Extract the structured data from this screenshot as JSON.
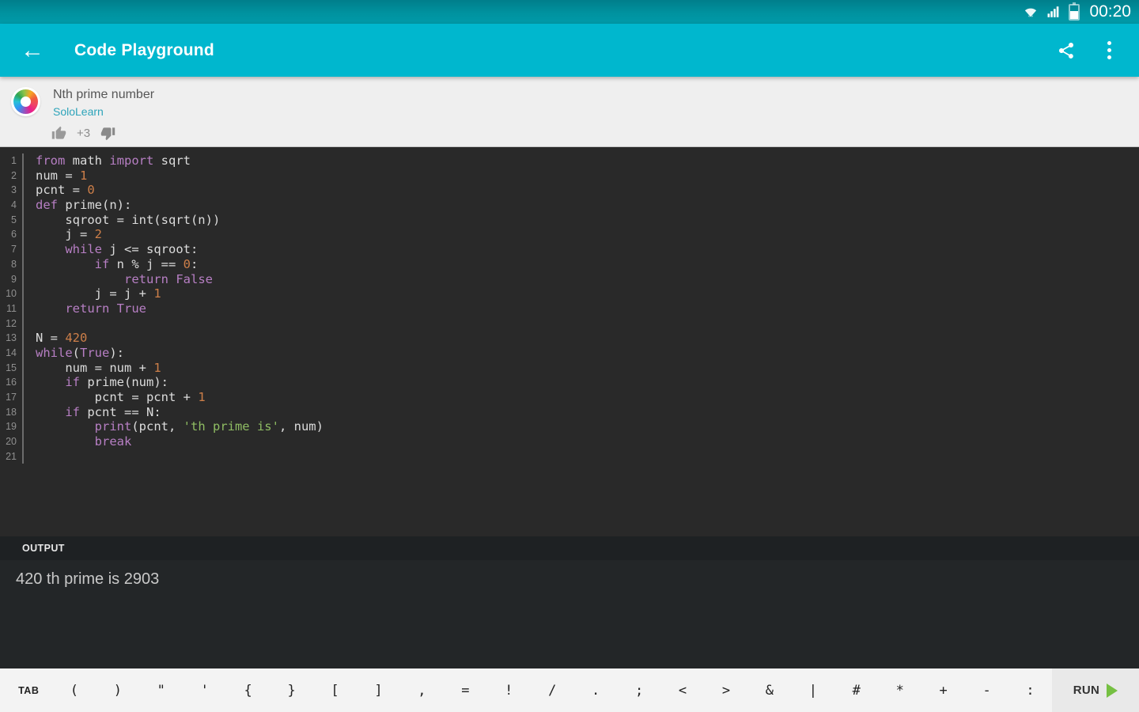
{
  "colors": {
    "accent": "#00b7ce",
    "keyword": "#b77fc4",
    "number": "#cd7f49",
    "string": "#8fbd63",
    "plain": "#dcdcdc",
    "run": "#76c043"
  },
  "status_bar": {
    "time": "00:20"
  },
  "app_bar": {
    "title": "Code Playground"
  },
  "code_header": {
    "title": "Nth prime number",
    "author": "SoloLearn",
    "votes": "+3"
  },
  "editor": {
    "lines": [
      {
        "n": "1",
        "seg": [
          [
            "k",
            "from"
          ],
          [
            "p",
            " math "
          ],
          [
            "k",
            "import"
          ],
          [
            "p",
            " sqrt"
          ]
        ]
      },
      {
        "n": "2",
        "seg": [
          [
            "p",
            "num = "
          ],
          [
            "n",
            "1"
          ]
        ]
      },
      {
        "n": "3",
        "seg": [
          [
            "p",
            "pcnt = "
          ],
          [
            "n",
            "0"
          ]
        ]
      },
      {
        "n": "4",
        "seg": [
          [
            "k",
            "def"
          ],
          [
            "p",
            " prime(n):"
          ]
        ]
      },
      {
        "n": "5",
        "seg": [
          [
            "p",
            "    sqroot = int(sqrt(n))"
          ]
        ]
      },
      {
        "n": "6",
        "seg": [
          [
            "p",
            "    j = "
          ],
          [
            "n",
            "2"
          ]
        ]
      },
      {
        "n": "7",
        "seg": [
          [
            "p",
            "    "
          ],
          [
            "k",
            "while"
          ],
          [
            "p",
            " j <= sqroot:"
          ]
        ]
      },
      {
        "n": "8",
        "seg": [
          [
            "p",
            "        "
          ],
          [
            "k",
            "if"
          ],
          [
            "p",
            " n % j == "
          ],
          [
            "n",
            "0"
          ],
          [
            "p",
            ":"
          ]
        ]
      },
      {
        "n": "9",
        "seg": [
          [
            "p",
            "            "
          ],
          [
            "k",
            "return"
          ],
          [
            "p",
            " "
          ],
          [
            "k",
            "False"
          ]
        ]
      },
      {
        "n": "10",
        "seg": [
          [
            "p",
            "        j = j + "
          ],
          [
            "n",
            "1"
          ]
        ]
      },
      {
        "n": "11",
        "seg": [
          [
            "p",
            "    "
          ],
          [
            "k",
            "return"
          ],
          [
            "p",
            " "
          ],
          [
            "k",
            "True"
          ]
        ]
      },
      {
        "n": "12",
        "seg": []
      },
      {
        "n": "13",
        "seg": [
          [
            "p",
            "N = "
          ],
          [
            "n",
            "420"
          ]
        ]
      },
      {
        "n": "14",
        "seg": [
          [
            "k",
            "while"
          ],
          [
            "p",
            "("
          ],
          [
            "k",
            "True"
          ],
          [
            "p",
            "):"
          ]
        ]
      },
      {
        "n": "15",
        "seg": [
          [
            "p",
            "    num = num + "
          ],
          [
            "n",
            "1"
          ]
        ]
      },
      {
        "n": "16",
        "seg": [
          [
            "p",
            "    "
          ],
          [
            "k",
            "if"
          ],
          [
            "p",
            " prime(num):"
          ]
        ]
      },
      {
        "n": "17",
        "seg": [
          [
            "p",
            "        pcnt = pcnt + "
          ],
          [
            "n",
            "1"
          ]
        ]
      },
      {
        "n": "18",
        "seg": [
          [
            "p",
            "    "
          ],
          [
            "k",
            "if"
          ],
          [
            "p",
            " pcnt == N:"
          ]
        ]
      },
      {
        "n": "19",
        "seg": [
          [
            "p",
            "        "
          ],
          [
            "k",
            "print"
          ],
          [
            "p",
            "(pcnt, "
          ],
          [
            "s",
            "'th prime is'"
          ],
          [
            "p",
            ", num)"
          ]
        ]
      },
      {
        "n": "20",
        "seg": [
          [
            "p",
            "        "
          ],
          [
            "k",
            "break"
          ]
        ]
      },
      {
        "n": "21",
        "seg": []
      }
    ]
  },
  "output": {
    "label": "OUTPUT",
    "text": "420 th prime is 2903"
  },
  "keyboard_bar": {
    "keys": [
      "TAB",
      "(",
      ")",
      "\"",
      "'",
      "{",
      "}",
      "[",
      "]",
      ",",
      "=",
      "!",
      "/",
      ".",
      ";",
      "<",
      ">",
      "&",
      "|",
      "#",
      "*",
      "+",
      "-",
      ":"
    ],
    "run_label": "RUN"
  }
}
